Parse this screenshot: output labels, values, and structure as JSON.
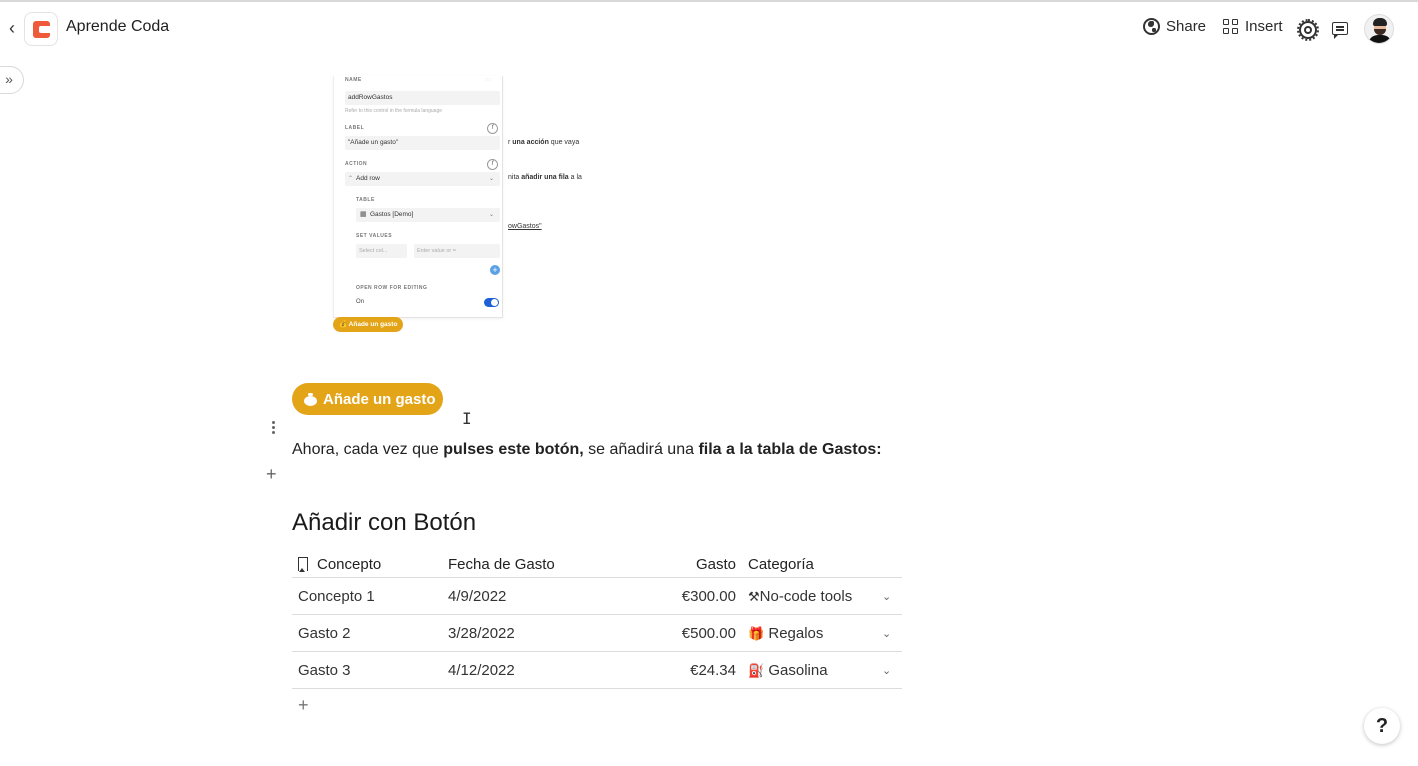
{
  "app": {
    "doc_title": "Aprende Coda",
    "share_label": "Share",
    "insert_label": "Insert"
  },
  "embedded_screenshot": {
    "name_label": "NAME",
    "name_value": "addRowGastos",
    "name_hint": "Refer to this control in the formula language",
    "label_label": "LABEL",
    "label_value": "\"Añade un gasto\"",
    "action_label": "ACTION",
    "action_value": "Add row",
    "table_label": "TABLE",
    "table_value": "Gastos [Demo]",
    "set_values_label": "SET VALUES",
    "select_col": "Select col...",
    "enter_value": "Enter value or =",
    "open_row_label": "OPEN ROW FOR EDITING",
    "open_row_value": "On",
    "mini_button": "Añade un gasto",
    "frag1_bold": "una acción",
    "frag1_rest": " que vaya",
    "frag1_prefix": "r ",
    "frag2_prefix": "nita ",
    "frag2_bold": "añadir una fila",
    "frag2_rest": " a la",
    "frag3": "owGastos\""
  },
  "button": {
    "label": "Añade un gasto"
  },
  "paragraph": {
    "t1": "Ahora, cada vez que ",
    "b1": "pulses este botón,",
    "t2": " se añadirá una ",
    "b2": "fila a la tabla de Gastos:"
  },
  "section": {
    "heading": "Añadir con Botón"
  },
  "table": {
    "columns": [
      "Concepto",
      "Fecha de Gasto",
      "Gasto",
      "Categoría"
    ],
    "rows": [
      {
        "concepto": "Concepto 1",
        "fecha": "4/9/2022",
        "gasto": "€300.00",
        "categoria_icon": "⚒",
        "categoria": "No-code tools"
      },
      {
        "concepto": "Gasto 2",
        "fecha": "3/28/2022",
        "gasto": "€500.00",
        "categoria_icon": "🎁",
        "categoria": "Regalos"
      },
      {
        "concepto": "Gasto 3",
        "fecha": "4/12/2022",
        "gasto": "€24.34",
        "categoria_icon": "⛽",
        "categoria": "Gasolina"
      }
    ]
  },
  "colors": {
    "accent_button": "#e3a418",
    "logo": "#ee5a3a",
    "toggle_on": "#1d5fd6"
  },
  "icons": {
    "back": "‹",
    "sidebar_toggle": "»",
    "add": "+",
    "help": "?",
    "chevron": "⌄"
  }
}
